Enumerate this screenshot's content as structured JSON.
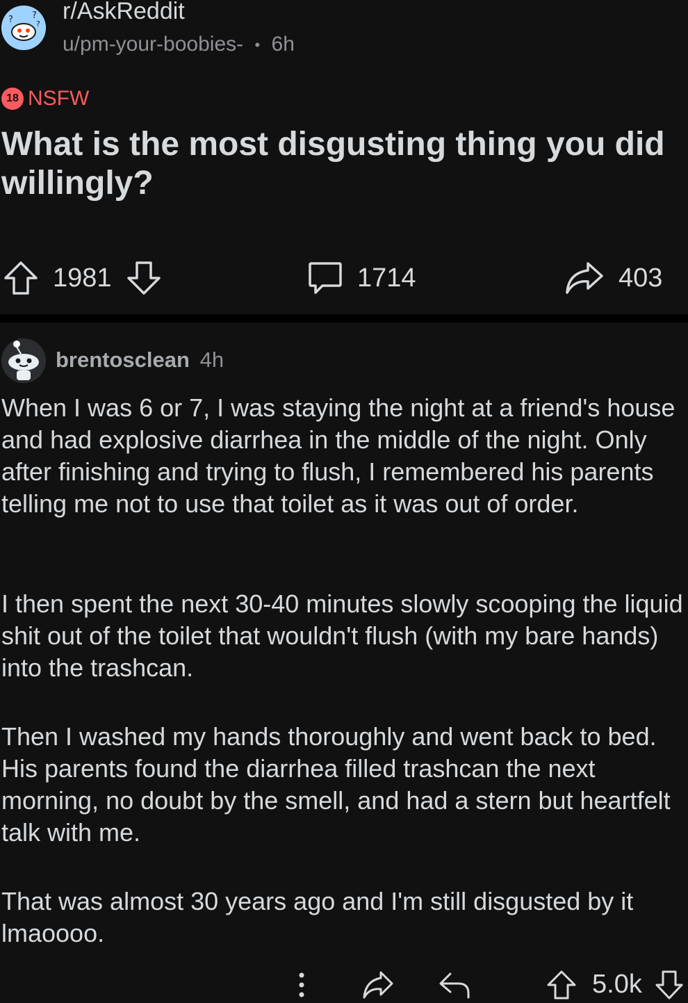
{
  "post": {
    "subreddit": "r/AskReddit",
    "author": "u/pm-your-boobies-",
    "separator": "•",
    "age": "6h",
    "nsfw_badge": "18",
    "nsfw_label": "NSFW",
    "title": "What is the most disgusting thing you did willingly?",
    "votes": "1981",
    "comments": "1714",
    "shares": "403"
  },
  "comment": {
    "author": "brentosclean",
    "age": "4h",
    "paragraphs": [
      "When I was 6 or 7, I was staying the night at a friend's house and had explosive diarrhea in the middle of the night. Only after finishing and trying to flush, I remembered his parents telling me not to use that toilet as it was out of order.",
      "I then spent the next 30-40 minutes slowly scooping the liquid shit out of the toilet that wouldn't flush (with my bare hands) into the trashcan.",
      "Then I washed my hands thoroughly and went back to bed. His parents found the diarrhea filled trashcan the next morning, no doubt by the smell, and had a stern but heartfelt talk with me.",
      "That was almost 30 years ago and I'm still disgusted by it lmaoooo."
    ],
    "votes": "5.0k"
  },
  "icons": {
    "subreddit_avatar": "askreddit-snoo-icon",
    "upvote": "upvote-arrow-icon",
    "downvote": "downvote-arrow-icon",
    "comments": "comment-bubble-icon",
    "share": "share-arrow-icon",
    "more": "more-vertical-icon",
    "reply": "reply-arrow-icon",
    "user_avatar": "snoo-avatar-icon"
  },
  "colors": {
    "background": "#111112",
    "text": "#d7dadc",
    "muted": "#8f9194",
    "nsfw": "#ff5a5f",
    "subreddit_avatar_bg": "#9fd3ff"
  }
}
